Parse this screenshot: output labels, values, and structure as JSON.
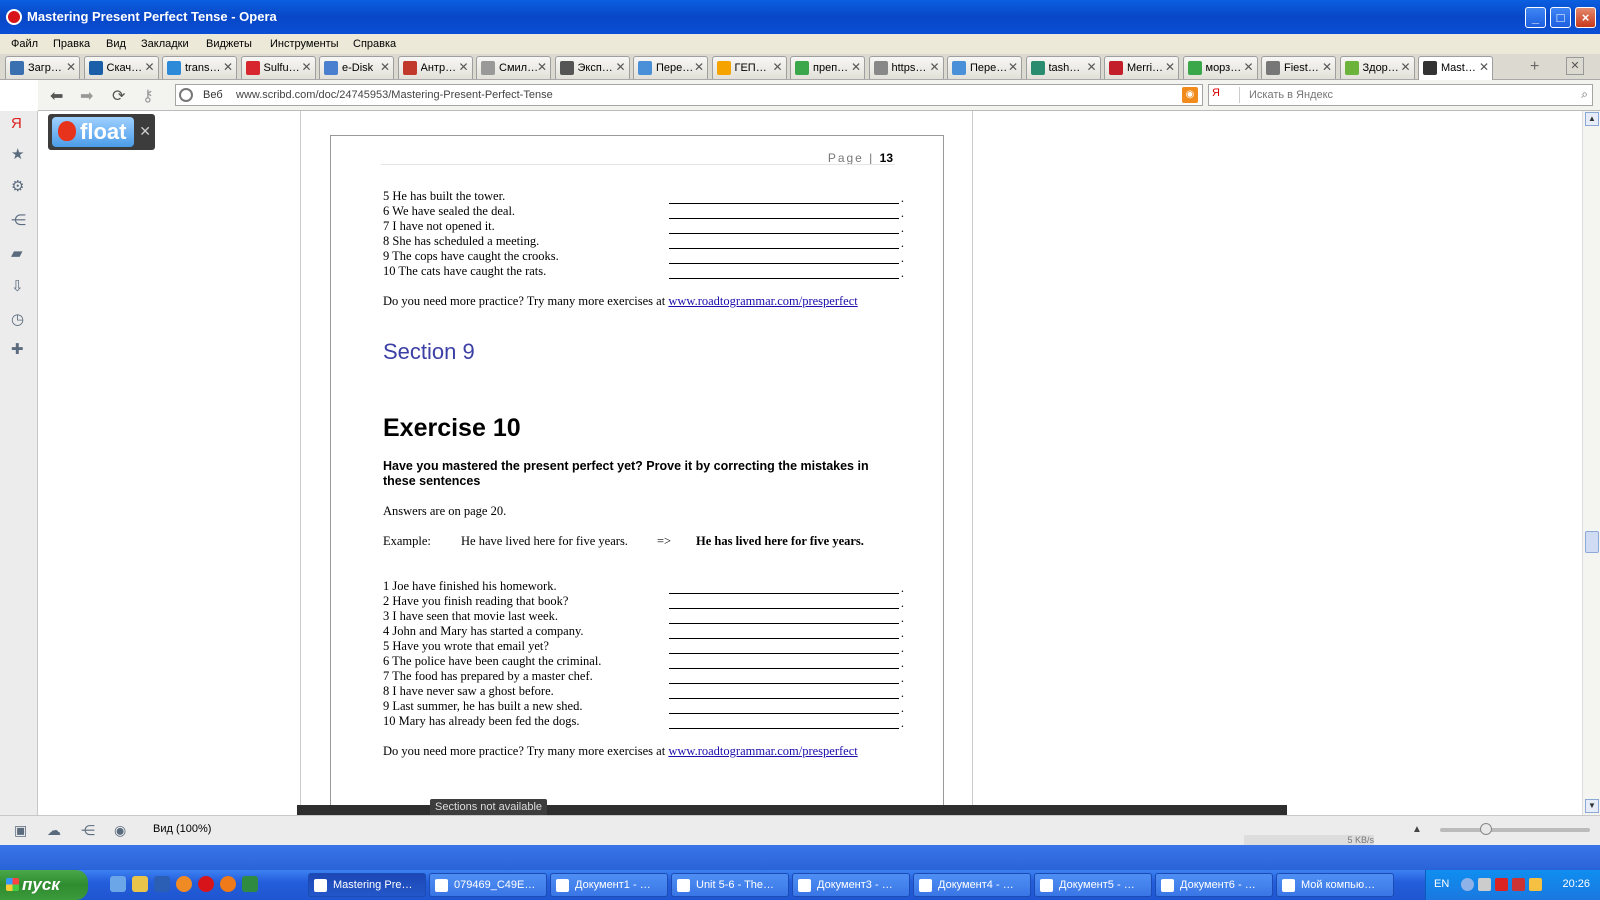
{
  "window": {
    "title": "Mastering Present Perfect Tense - Opera"
  },
  "menu": [
    "Файл",
    "Правка",
    "Вид",
    "Закладки",
    "Виджеты",
    "Инструменты",
    "Справка"
  ],
  "tabs": [
    {
      "label": "Загр…",
      "color": "#3a6fb0"
    },
    {
      "label": "Скач…",
      "color": "#1b5fa8"
    },
    {
      "label": "trans…",
      "color": "#2d8ad8"
    },
    {
      "label": "Sulfu…",
      "color": "#d8262e"
    },
    {
      "label": "e-Disk",
      "color": "#4a7fd0"
    },
    {
      "label": "Антр…",
      "color": "#c0392b"
    },
    {
      "label": "Смил…",
      "color": "#999999"
    },
    {
      "label": "Эксп…",
      "color": "#555555"
    },
    {
      "label": "Пере…",
      "color": "#4a90d9"
    },
    {
      "label": "ГЕП…",
      "color": "#f4a300"
    },
    {
      "label": "преп…",
      "color": "#3aa84a"
    },
    {
      "label": "https…",
      "color": "#888888"
    },
    {
      "label": "Пере…",
      "color": "#4a90d9"
    },
    {
      "label": "tash…",
      "color": "#2a8c6e"
    },
    {
      "label": "Merri…",
      "color": "#c21f2a"
    },
    {
      "label": "морз…",
      "color": "#3aa84a"
    },
    {
      "label": "Fiest…",
      "color": "#777777"
    },
    {
      "label": "Здор…",
      "color": "#6bb33a"
    },
    {
      "label": "Mast…",
      "color": "#333333"
    }
  ],
  "address": {
    "context": "Веб",
    "url": "www.scribd.com/doc/24745953/Mastering-Present-Perfect-Tense"
  },
  "search": {
    "engine": "Я",
    "placeholder": "Искать в Яндекс"
  },
  "float_widget": {
    "label": "float"
  },
  "doc": {
    "page_label": "Page |",
    "page_number": "13",
    "list_top": [
      "5 He has built the tower.",
      "6 We have sealed the deal.",
      "7 I have not opened it.",
      "8 She has scheduled a meeting.",
      "9 The cops have caught the crooks.",
      "10 The cats have caught the rats."
    ],
    "practice_text": "Do you need more practice? Try many more exercises at",
    "practice_link": "www.roadtogrammar.com/presperfect",
    "section_title": "Section 9",
    "exercise_title": "Exercise 10",
    "instruction": "Have you mastered the present perfect yet? Prove it by correcting the mistakes in these sentences",
    "answers": "Answers are on page 20.",
    "example_label": "Example:",
    "example_wrong": "He have lived here for five years.",
    "example_arrow": "=>",
    "example_right": "He has lived here for five years.",
    "list_bottom": [
      "1 Joe have finished his homework.",
      "2 Have you finish reading that book?",
      "3 I have seen that movie last week.",
      "4 John and Mary has started a company.",
      "5 Have you wrote that email yet?",
      "6 The police have been caught the criminal.",
      "7 The food has prepared by a master chef.",
      "8 I have never saw a ghost before.",
      "9 Last summer, he has built a new shed.",
      "10 Mary has already been fed the dogs."
    ],
    "tooltip": "Sections not available"
  },
  "status": {
    "zoom_label": "Вид (100%)",
    "speed": "5 KB/s"
  },
  "taskbar": {
    "start": "пуск",
    "tasks": [
      {
        "label": "Mastering Pre…",
        "active": true
      },
      {
        "label": "079469_C49E…",
        "active": false
      },
      {
        "label": "Документ1 - …",
        "active": false
      },
      {
        "label": "Unit 5-6 - The…",
        "active": false
      },
      {
        "label": "Документ3 - …",
        "active": false
      },
      {
        "label": "Документ4 - …",
        "active": false
      },
      {
        "label": "Документ5 - …",
        "active": false
      },
      {
        "label": "Документ6 - …",
        "active": false
      },
      {
        "label": "Мой компью…",
        "active": false
      }
    ],
    "lang": "EN",
    "clock": "20:26"
  }
}
